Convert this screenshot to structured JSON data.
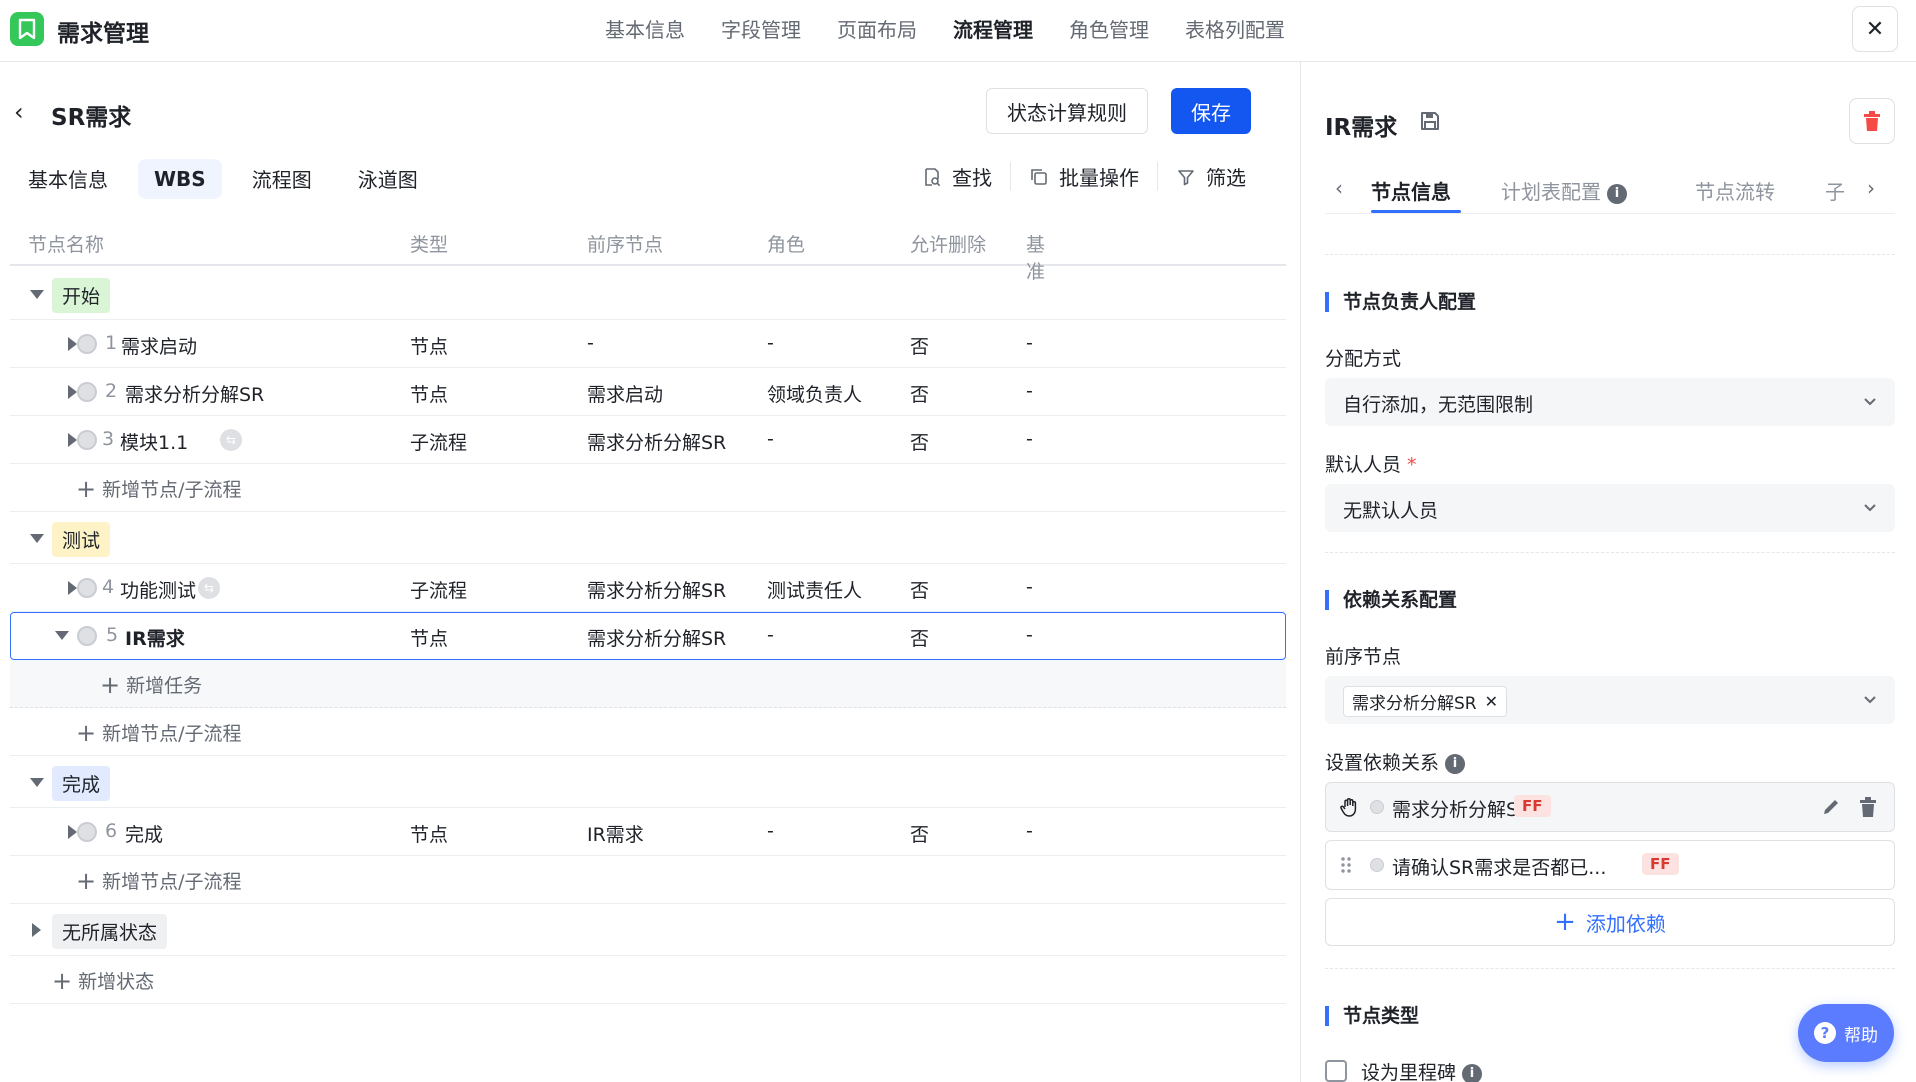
{
  "app": {
    "title": "需求管理",
    "close_label": "✕"
  },
  "top_tabs": [
    "基本信息",
    "字段管理",
    "页面布局",
    "流程管理",
    "角色管理",
    "表格列配置"
  ],
  "left": {
    "title": "SR需求",
    "btn_rules": "状态计算规则",
    "btn_save": "保存",
    "sub_tabs": [
      "基本信息",
      "WBS",
      "流程图",
      "泳道图"
    ],
    "tools": {
      "search": "查找",
      "batch": "批量操作",
      "filter": "筛选"
    },
    "columns": [
      "节点名称",
      "类型",
      "前序节点",
      "角色",
      "允许删除",
      "基准"
    ],
    "groups": [
      {
        "label": "开始",
        "color": "green"
      },
      {
        "label": "测试",
        "color": "yellow"
      },
      {
        "label": "完成",
        "color": "blue"
      },
      {
        "label": "无所属状态",
        "color": "gray"
      }
    ],
    "rows": [
      {
        "idx": "1",
        "name": "需求启动",
        "type": "节点",
        "pred": "-",
        "role": "-",
        "del": "否",
        "base": "-"
      },
      {
        "idx": "2",
        "name": "需求分析分解SR",
        "type": "节点",
        "pred": "需求启动",
        "role": "领域负责人",
        "del": "否",
        "base": "-"
      },
      {
        "idx": "3",
        "name": "模块1.1",
        "type": "子流程",
        "pred": "需求分析分解SR",
        "role": "-",
        "del": "否",
        "base": "-"
      },
      {
        "idx": "4",
        "name": "功能测试",
        "type": "子流程",
        "pred": "需求分析分解SR",
        "role": "测试责任人",
        "del": "否",
        "base": "-"
      },
      {
        "idx": "5",
        "name": "IR需求",
        "type": "节点",
        "pred": "需求分析分解SR",
        "role": "-",
        "del": "否",
        "base": "-"
      },
      {
        "idx": "6",
        "name": "完成",
        "type": "节点",
        "pred": "IR需求",
        "role": "-",
        "del": "否",
        "base": "-"
      }
    ],
    "add_node": "新增节点/子流程",
    "add_task": "新增任务",
    "add_state": "新增状态"
  },
  "right": {
    "title": "IR需求",
    "tabs": [
      "节点信息",
      "计划表配置",
      "节点流转",
      "子"
    ],
    "section_owner": "节点负责人配置",
    "assign_label": "分配方式",
    "assign_value": "自行添加，无范围限制",
    "default_label": "默认人员",
    "default_value": "无默认人员",
    "section_dep": "依赖关系配置",
    "pred_label": "前序节点",
    "pred_chip": "需求分析分解SR",
    "set_dep_label": "设置依赖关系",
    "deps": [
      {
        "name": "需求分析分解SR",
        "badge": "FF"
      },
      {
        "name": "请确认SR需求是否都已...",
        "badge": "FF"
      }
    ],
    "add_dep": "添加依赖",
    "section_type": "节点类型",
    "milestone_label": "设为里程碑",
    "help_label": "帮助"
  }
}
